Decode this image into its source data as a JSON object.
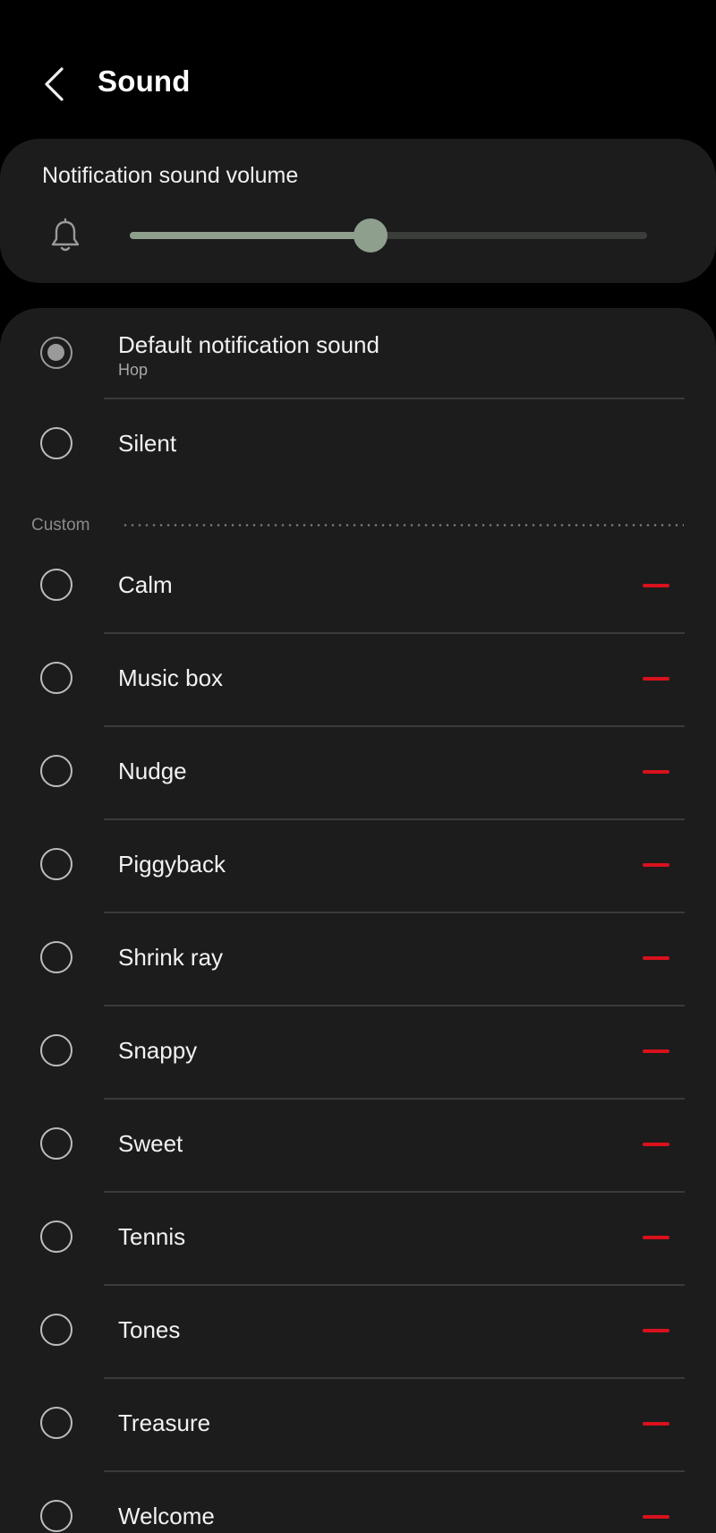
{
  "header": {
    "title": "Sound"
  },
  "volume": {
    "label": "Notification sound volume",
    "level": 0.465
  },
  "options": [
    {
      "label": "Default notification sound",
      "sublabel": "Hop",
      "selected": true
    },
    {
      "label": "Silent",
      "selected": false
    }
  ],
  "custom_section": {
    "label": "Custom"
  },
  "custom_sounds": [
    {
      "label": "Calm"
    },
    {
      "label": "Music box"
    },
    {
      "label": "Nudge"
    },
    {
      "label": "Piggyback"
    },
    {
      "label": "Shrink ray"
    },
    {
      "label": "Snappy"
    },
    {
      "label": "Sweet"
    },
    {
      "label": "Tennis"
    },
    {
      "label": "Tones"
    },
    {
      "label": "Treasure"
    },
    {
      "label": "Welcome"
    }
  ],
  "colors": {
    "background": "#000000",
    "card": "#1c1c1c",
    "accent": "#8f9f8e",
    "remove": "#d9111c"
  }
}
